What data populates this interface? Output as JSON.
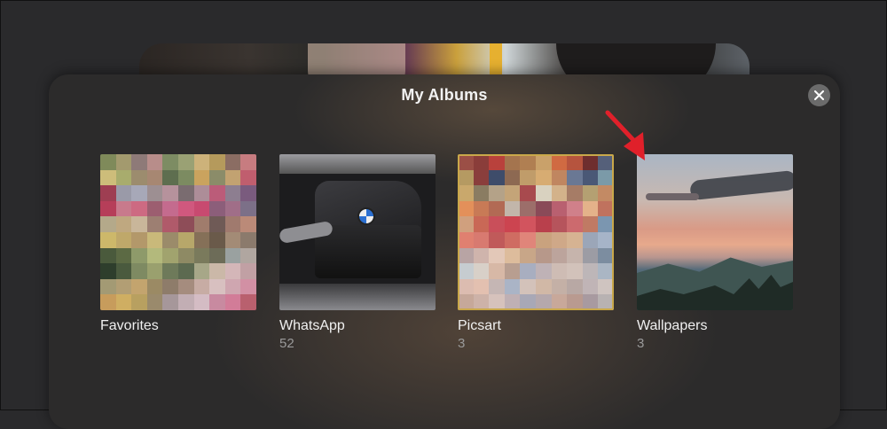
{
  "dialog": {
    "title": "My Albums"
  },
  "albums": [
    {
      "name": "Favorites",
      "count": ""
    },
    {
      "name": "WhatsApp",
      "count": "52"
    },
    {
      "name": "Picsart",
      "count": "3"
    },
    {
      "name": "Wallpapers",
      "count": "3"
    }
  ],
  "icons": {
    "close": "close-icon",
    "annotation": "red-arrow-icon"
  },
  "colors": {
    "sheet": "#2c2b2b",
    "close_button": "#6b6b6b",
    "arrow": "#e0202a"
  },
  "mosaics": {
    "favorites": [
      "#7f8a5a",
      "#a39a6e",
      "#8e7a78",
      "#b88d8a",
      "#7d8c63",
      "#9aa174",
      "#cdb27a",
      "#b59a5c",
      "#8b6d63",
      "#c77c80",
      "#cdbd7a",
      "#a8ac6d",
      "#9c8c6e",
      "#a78772",
      "#5e6e4f",
      "#7c8b61",
      "#caa35e",
      "#8b8c69",
      "#c2a271",
      "#c05e6e",
      "#9e3e52",
      "#9a9aa8",
      "#a7a8b8",
      "#9d8f92",
      "#b6929c",
      "#7a6c70",
      "#ad8d98",
      "#bb5c79",
      "#8d7e90",
      "#7a5b7e",
      "#b63e59",
      "#c87a8c",
      "#cd6a82",
      "#9c5e70",
      "#c46b8e",
      "#d0587e",
      "#c84a70",
      "#8c5e7a",
      "#a06e88",
      "#7c7088",
      "#b4a98a",
      "#bfa880",
      "#c9b69a",
      "#9d7f72",
      "#b05a6a",
      "#8e4d58",
      "#a07c6c",
      "#6f5a56",
      "#a07a6e",
      "#bb8a78",
      "#cdb86a",
      "#bfa86a",
      "#b3986a",
      "#c9b97a",
      "#9b8b6a",
      "#b7a76a",
      "#857058",
      "#6a5a4a",
      "#a38b76",
      "#8b7a6c",
      "#4a5a3c",
      "#5c6a44",
      "#8e9a6a",
      "#b3b97c",
      "#a1a36e",
      "#8e8a64",
      "#7a7a5c",
      "#6d6c58",
      "#9aa1a0",
      "#b0a6a0",
      "#2e3e2c",
      "#4a5a3e",
      "#7e8a62",
      "#9aa06e",
      "#6e7a5a",
      "#5c6a50",
      "#a7a788",
      "#cbb8a8",
      "#d4b6b8",
      "#c1a0a4",
      "#a39a74",
      "#b29e74",
      "#c3a46e",
      "#9b8a64",
      "#8e7c6a",
      "#a58c7e",
      "#c7aca4",
      "#d8c0c0",
      "#cfa6b0",
      "#d290a4",
      "#c79c5c",
      "#cfae62",
      "#b8a060",
      "#9a8a6c",
      "#a6979a",
      "#c2aeb4",
      "#d4bcc4",
      "#c88aa0",
      "#d27c98",
      "#b9606e"
    ],
    "picsart": [
      "#9b4f46",
      "#8a3d3a",
      "#b9413c",
      "#a4744e",
      "#b07f52",
      "#c9a16a",
      "#d06a42",
      "#b6543e",
      "#6e2e2e",
      "#55607a",
      "#b59a62",
      "#8a3e3c",
      "#3e4c6a",
      "#8d6952",
      "#c09c6a",
      "#d7ac72",
      "#c08660",
      "#6a7894",
      "#4a5876",
      "#7b9aa8",
      "#c9a86c",
      "#8a7c62",
      "#b4a288",
      "#c4a478",
      "#a84a4e",
      "#d9d2c0",
      "#d3b28a",
      "#a67c66",
      "#b4a072",
      "#c38a64",
      "#e3905a",
      "#c87a56",
      "#b26a54",
      "#c2b6aa",
      "#9c6e6a",
      "#8a4a58",
      "#b96070",
      "#d0808a",
      "#e4b28a",
      "#c0725e",
      "#d0a07e",
      "#c96856",
      "#c94f5a",
      "#cc4450",
      "#d2545e",
      "#b9404c",
      "#b6545c",
      "#cc6a6e",
      "#c07a64",
      "#7b96b0",
      "#e08070",
      "#d87a70",
      "#c05a5a",
      "#cf6c62",
      "#e0857a",
      "#c9a27e",
      "#cfa888",
      "#d6b392",
      "#9ba6b8",
      "#a6b4c8",
      "#b8a4a4",
      "#cfb4ac",
      "#e3c8b8",
      "#ddbc9c",
      "#c8a688",
      "#b7988a",
      "#bca49c",
      "#c6b4ac",
      "#9c9ca4",
      "#7c8da0",
      "#c6ccd0",
      "#d8d0c8",
      "#d7b8a6",
      "#b89e90",
      "#a8aec0",
      "#bfb2b6",
      "#cebcb4",
      "#d2c2ba",
      "#bdb6b8",
      "#aab6c4",
      "#dcbcb0",
      "#e3c0b0",
      "#c5b6b4",
      "#aab4c6",
      "#d3c2ba",
      "#d1b8a6",
      "#c4b0a6",
      "#b8a8a4",
      "#c0b4b6",
      "#cfc4c0",
      "#c6a89a",
      "#cdb2a8",
      "#d6c2bc",
      "#bfb0b4",
      "#a8a8b6",
      "#b5a8ac",
      "#c8a89a",
      "#b99a90",
      "#a89aa0",
      "#b8b2b2"
    ]
  }
}
